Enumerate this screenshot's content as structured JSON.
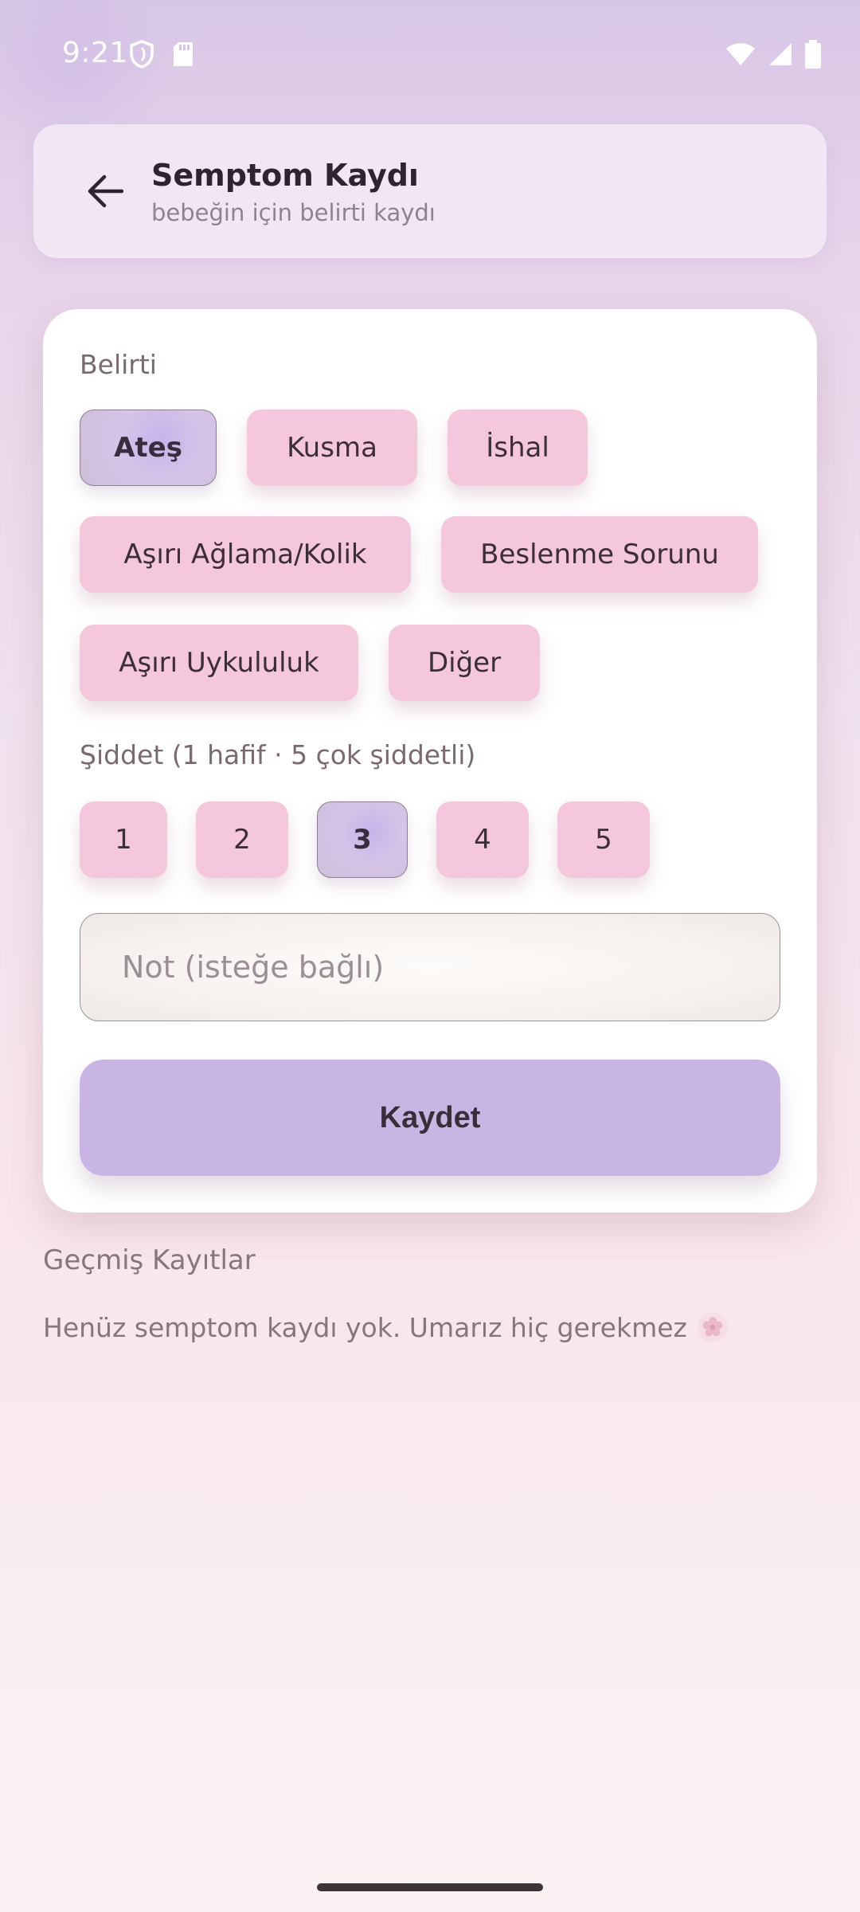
{
  "status_bar": {
    "time": "9:21",
    "left_icons": [
      "shield-icon",
      "sd-card-icon"
    ],
    "right_icons": [
      "wifi-icon",
      "signal-icon",
      "battery-icon"
    ]
  },
  "header": {
    "back_icon": "arrow-back-icon",
    "title": "Semptom Kaydı",
    "subtitle": "bebeğin için belirti kaydı"
  },
  "form": {
    "symptom_label": "Belirti",
    "symptoms": [
      {
        "label": "Ateş",
        "selected": true
      },
      {
        "label": "Kusma",
        "selected": false
      },
      {
        "label": "İshal",
        "selected": false
      },
      {
        "label": "Aşırı Ağlama/Kolik",
        "selected": false
      },
      {
        "label": "Beslenme Sorunu",
        "selected": false
      },
      {
        "label": "Aşırı Uykululuk",
        "selected": false
      },
      {
        "label": "Diğer",
        "selected": false
      }
    ],
    "severity_label": "Şiddet (1 hafif · 5 çok şiddetli)",
    "severity_options": [
      "1",
      "2",
      "3",
      "4",
      "5"
    ],
    "severity_selected": "3",
    "note_placeholder": "Not (isteğe bağlı)",
    "note_value": "",
    "save_label": "Kaydet"
  },
  "history": {
    "title": "Geçmiş Kayıtlar",
    "empty_text": "Henüz semptom kaydı yok. Umarız hiç gerekmez",
    "empty_icon": "flower-icon"
  },
  "colors": {
    "chip": "#f5c7dc",
    "chip_selected": "#cfbde6",
    "primary_button": "#c9b5e3",
    "card": "#ffffff"
  }
}
